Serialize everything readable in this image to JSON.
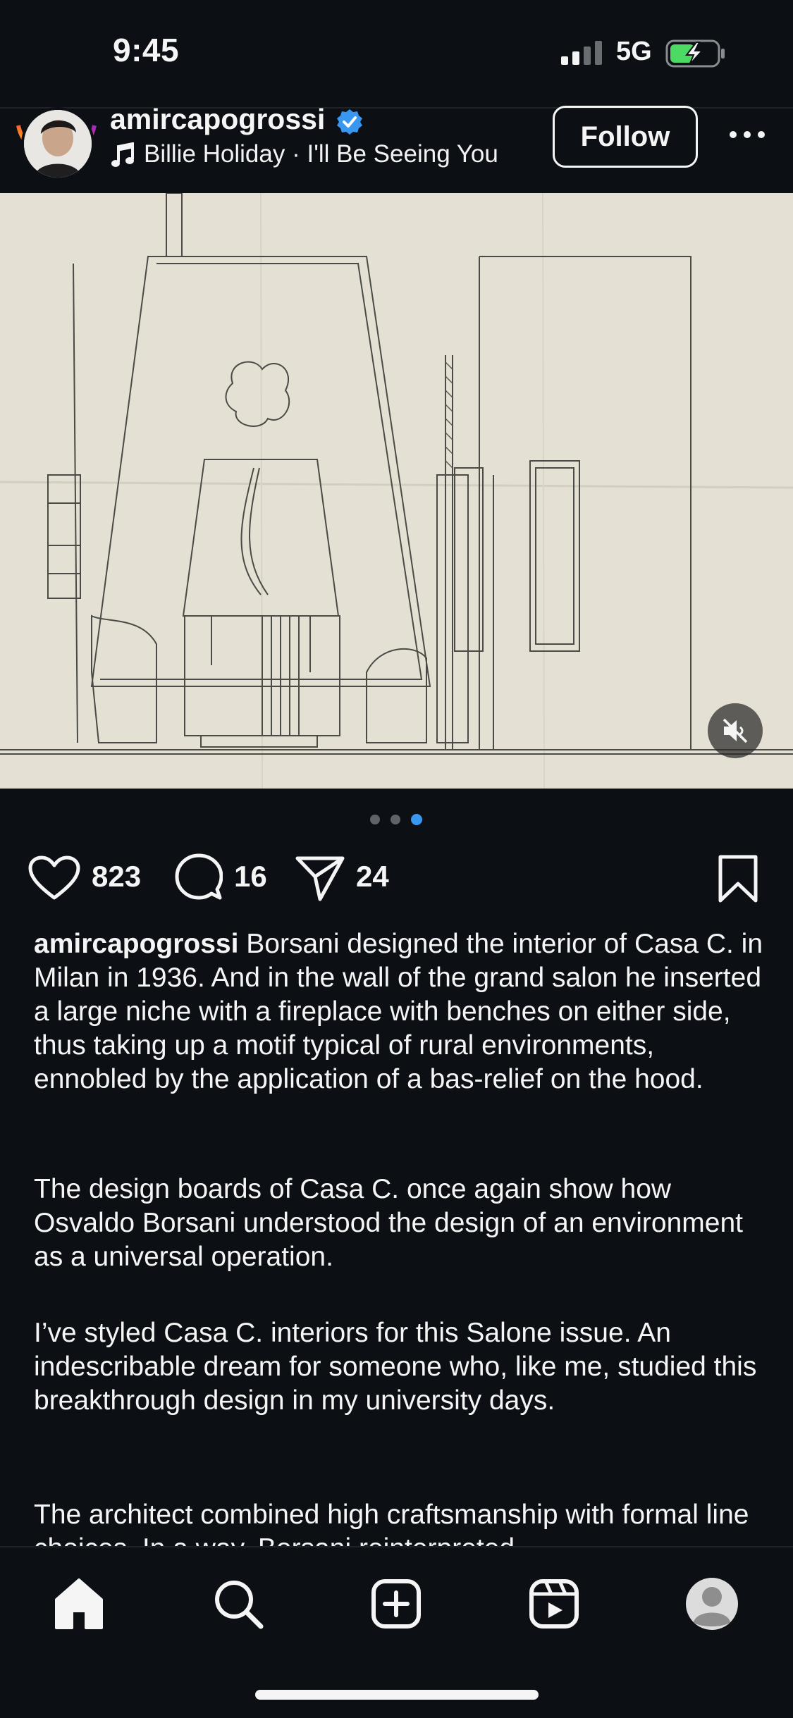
{
  "status_bar": {
    "time": "9:45",
    "network": "5G"
  },
  "post": {
    "username": "amircapogrossi",
    "audio_track": "Billie Holiday · I'll Be Seeing You",
    "follow_label": "Follow",
    "carousel": {
      "total": 3,
      "current": 3
    },
    "likes": "823",
    "comments": "16",
    "shares": "24",
    "caption": {
      "username": "amircapogrossi",
      "p1": "Borsani designed the interior of Casa C. in Milan in 1936. And in the wall of the grand salon he inserted a large niche with a fireplace with benches on either side, thus taking up a motif typical of rural environments, ennobled by the application of a bas-relief on the hood.",
      "p2": "The design boards of Casa C. once again show how Osvaldo Borsani understood the design of an environment as a universal operation.",
      "p3": "I’ve styled Casa C. interiors for this Salone issue. An indescribable dream for someone who, like me, studied this breakthrough design in my university days.",
      "p4": "The architect combined high craftsmanship with formal line choices. In a way, Borsani reinterpreted"
    }
  },
  "icons": {
    "verified": "verified-badge-icon",
    "music": "music-note-icon",
    "more": "more-options-icon",
    "mute": "speaker-muted-icon",
    "like": "heart-icon",
    "comment": "comment-bubble-icon",
    "share": "paper-plane-icon",
    "save": "bookmark-icon"
  },
  "nav": [
    "home",
    "search",
    "create",
    "reels",
    "profile"
  ],
  "colors": {
    "background": "#0c1014",
    "text": "#f5f5f5",
    "accent": "#3897f0",
    "battery": "#4cd964"
  }
}
